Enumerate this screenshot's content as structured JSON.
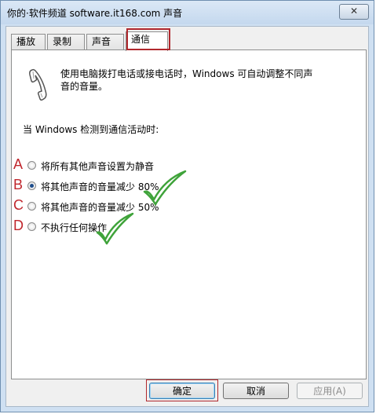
{
  "window": {
    "title": "你的·软件频道 software.it168.com    声音",
    "close_label": "✕"
  },
  "tabs": [
    {
      "label": "播放"
    },
    {
      "label": "录制"
    },
    {
      "label": "声音"
    },
    {
      "label": "通信"
    }
  ],
  "panel": {
    "icon": "phone-icon",
    "description": "使用电脑拨打电话或接电话时，Windows 可自动调整不同声音的音量。",
    "detect_label": "当 Windows 检测到通信活动时:",
    "options": [
      {
        "letter": "A",
        "label": "将所有其他声音设置为静音",
        "checked": false
      },
      {
        "letter": "B",
        "label": "将其他声音的音量减少 80%",
        "checked": true
      },
      {
        "letter": "C",
        "label": "将其他声音的音量减少 50%",
        "checked": false
      },
      {
        "letter": "D",
        "label": "不执行任何操作",
        "checked": false
      }
    ]
  },
  "buttons": {
    "ok": "确定",
    "cancel": "取消",
    "apply": "应用(A)"
  },
  "colors": {
    "annotation_red": "#c0272d",
    "checkmark_green": "#3fa33a",
    "window_frame": "#cfe0f2"
  }
}
